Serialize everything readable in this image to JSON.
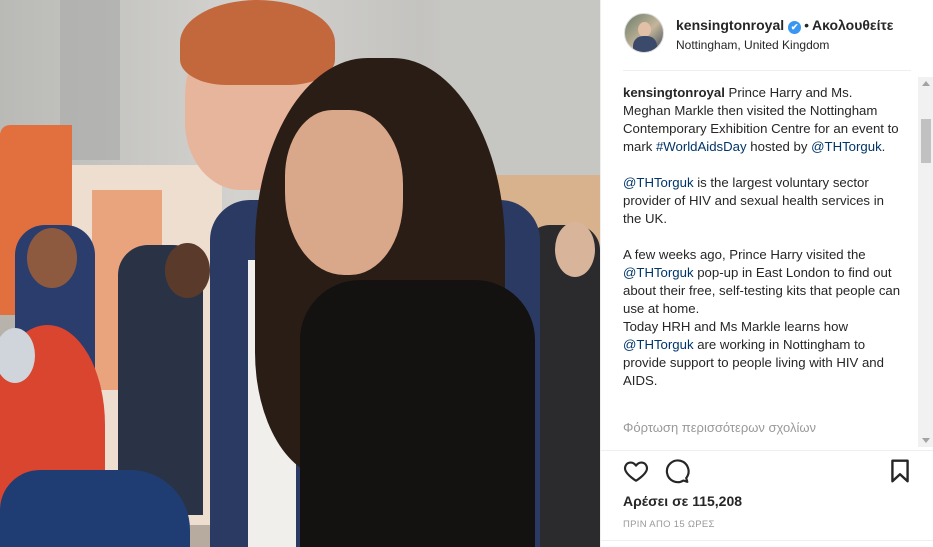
{
  "post": {
    "username": "kensingtonroyal",
    "verified_mark": "✔",
    "separator": "•",
    "follow_status": "Ακολουθείτε",
    "location": "Nottingham, United Kingdom"
  },
  "caption": {
    "username": "kensingtonroyal",
    "p1_text_a": " Prince Harry and Ms. Meghan Markle then visited the Nottingham Contemporary Exhibition Centre for an event to mark ",
    "p1_hashtag": "#WorldAidsDay",
    "p1_text_b": " hosted by ",
    "p1_mention": "@THTorguk",
    "p1_text_c": ".",
    "p2_mention": "@THTorguk",
    "p2_text": " is the largest voluntary sector provider of HIV and sexual health services in the UK.",
    "p3_text_a": "A few weeks ago, Prince Harry visited the ",
    "p3_mention": "@THTorguk",
    "p3_text_b": " pop-up in East London to find out about their free, self-testing kits that people can use at home.",
    "p4_text_a": "Today HRH and Ms Markle learns how ",
    "p4_mention": "@THTorguk",
    "p4_text_b": " are working in Nottingham to provide support to people living with HIV and AIDS."
  },
  "load_more": "Φόρτωση περισσότερων σχολίων",
  "likes": "Αρέσει σε 115,208",
  "timestamp": "ΠΡΙΝ ΑΠΟ 15 ΩΡΕΣ",
  "icons": {
    "like": "heart-icon",
    "comment": "comment-icon",
    "save": "bookmark-icon"
  },
  "colors": {
    "link": "#003569",
    "verified": "#3897f0",
    "muted": "#999999",
    "text": "#262626"
  }
}
